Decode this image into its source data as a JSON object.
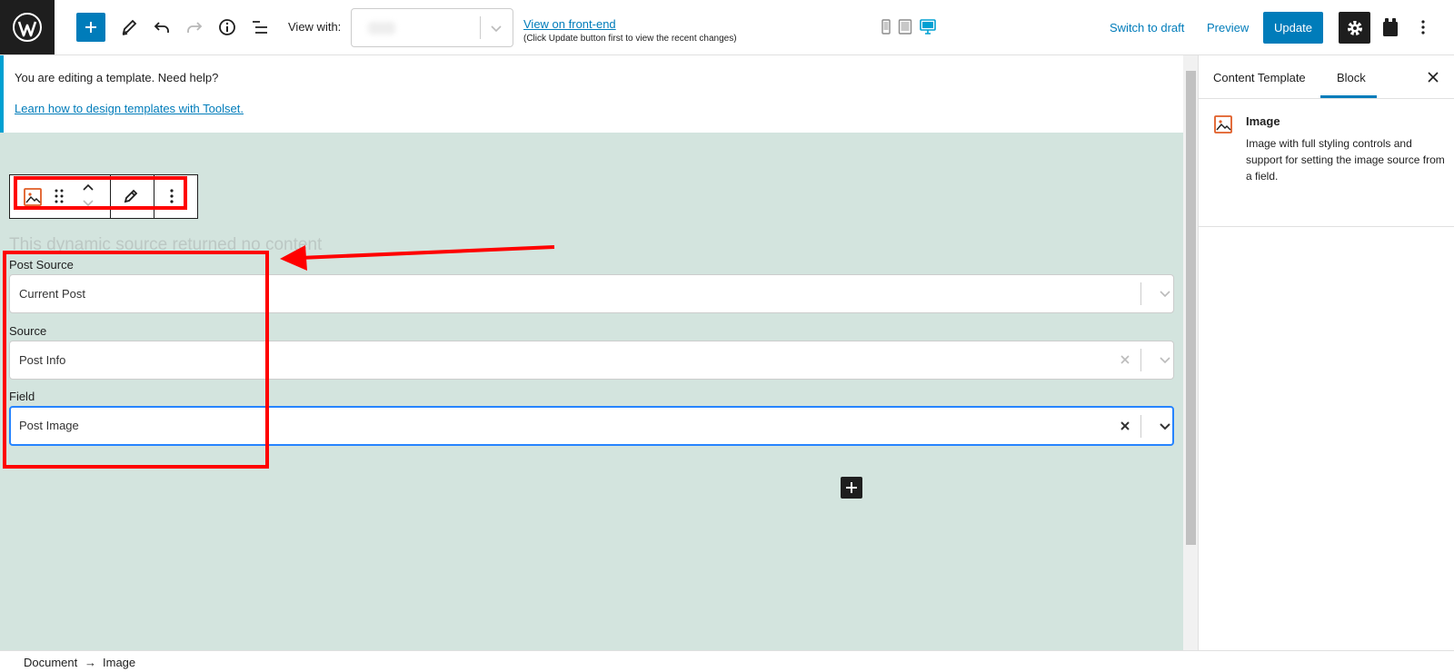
{
  "toolbar": {
    "view_with_label": "View with:",
    "view_front_end_link": "View on front-end",
    "view_front_end_hint": "(Click Update button first to view the recent changes)",
    "switch_to_draft": "Switch to draft",
    "preview": "Preview",
    "update": "Update",
    "active_device": "desktop"
  },
  "notice": {
    "text": "You are editing a template. Need help?",
    "link": "Learn how to design templates with Toolset."
  },
  "canvas": {
    "empty_message": "This dynamic source returned no content",
    "fields": [
      {
        "label": "Post Source",
        "value": "Current Post",
        "clearable": false
      },
      {
        "label": "Source",
        "value": "Post Info",
        "clearable": true
      },
      {
        "label": "Field",
        "value": "Post Image",
        "clearable": true,
        "focused": true
      }
    ]
  },
  "sidebar": {
    "tabs": [
      "Content Template",
      "Block"
    ],
    "active_tab": "Block",
    "block": {
      "title": "Image",
      "description": "Image with full styling controls and support for setting the image source from a field."
    }
  },
  "breadcrumb": [
    "Document",
    "→",
    "Image"
  ],
  "colors": {
    "accent": "#007cba",
    "canvas_bg": "#d3e4de",
    "annotation": "#ff0000",
    "block_icon": "#e05d26"
  }
}
